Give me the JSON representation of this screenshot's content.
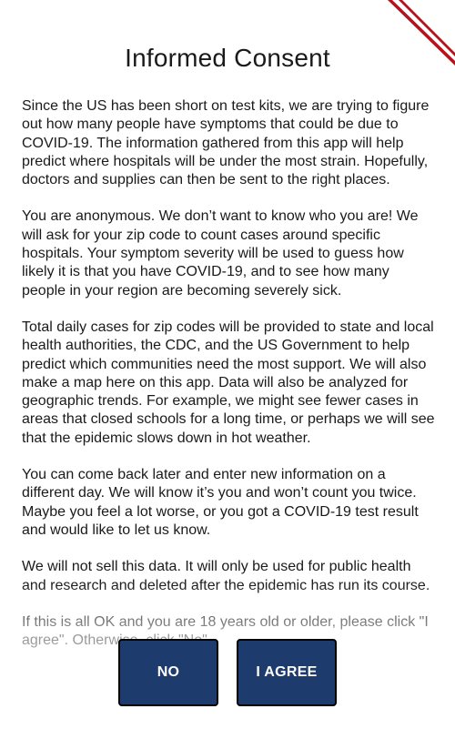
{
  "consent": {
    "title": "Informed Consent",
    "paragraphs": [
      "Since the US has been short on test kits, we are trying to figure out how many people have symptoms that could be due to COVID-19. The information gathered from this app will help predict where hospitals will be under the most strain. Hopefully, doctors and supplies can then be sent to the right places.",
      "You are anonymous. We don’t want to know who you are! We will ask for your zip code to count cases around specific hospitals. Your symptom severity will be used to guess how likely it is that you have COVID-19, and to see how many people in your region are becoming severely sick.",
      "Total daily cases for zip codes will be provided to state and local health authorities, the CDC, and the US Government to help predict which communities need the most support. We will also make a map here on this app. Data will also be analyzed for geographic trends. For example, we might see fewer cases in areas that closed schools for a long time, or perhaps we will see that the epidemic slows down in hot weather.",
      "You can come back later and enter new information on a different day. We will know it’s you and won’t count you twice. Maybe you feel a lot worse, or you got a COVID-19 test result and would like to let us know.",
      "We will not sell this data. It will only be used for public health and research and deleted after the epidemic has run its course.",
      "If this is all OK and you are 18 years old or older, please click \"I agree\". Otherwise, click \"No\"."
    ]
  },
  "actions": {
    "no_label": "NO",
    "agree_label": "I AGREE"
  },
  "colors": {
    "button_bg": "#1d3b6c",
    "ribbon": "#b5121b"
  }
}
